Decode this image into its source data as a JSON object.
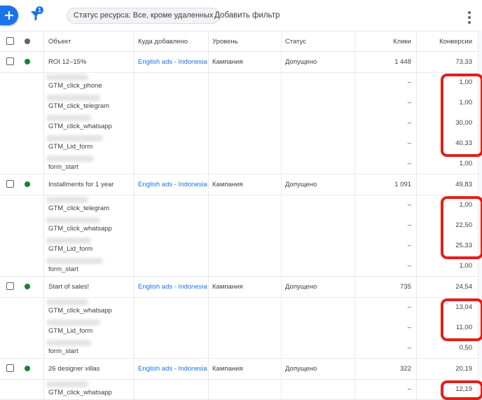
{
  "toolbar": {
    "add_icon": "plus-icon",
    "filter_icon": "filter-icon",
    "filter_badge": "1",
    "status_chip": "Статус ресурса: Все, кроме удаленных",
    "add_filter": "Добавить фильтр",
    "more_icon": "more-vert-icon"
  },
  "columns": {
    "object": "Объект",
    "added_to": "Куда добавлено",
    "level": "Уровень",
    "status": "Статус",
    "clicks": "Клики",
    "conversions": "Конверсии"
  },
  "colors": {
    "accent": "#1a73e8",
    "status_green": "#188038",
    "highlight": "#e0201b"
  },
  "campaigns": [
    {
      "name": "ROI 12–15%",
      "added_to": "English ads - Indonesia",
      "level": "Кампания",
      "status": "Допущено",
      "clicks": "1 448",
      "conversions": "73,33",
      "actions": [
        {
          "name": "GTM_click_phone",
          "clicks": "–",
          "conversions": "1,00"
        },
        {
          "name": "GTM_click_telegram",
          "clicks": "–",
          "conversions": "1,00"
        },
        {
          "name": "GTM_click_whatsapp",
          "clicks": "–",
          "conversions": "30,00"
        },
        {
          "name": "GTM_Lid_form",
          "clicks": "–",
          "conversions": "40,33"
        },
        {
          "name": "form_start",
          "clicks": "–",
          "conversions": "1,00"
        }
      ]
    },
    {
      "name": "Installments for 1 year",
      "added_to": "English ads - Indonesia",
      "level": "Кампания",
      "status": "Допущено",
      "clicks": "1 091",
      "conversions": "49,83",
      "actions": [
        {
          "name": "GTM_click_telegram",
          "clicks": "–",
          "conversions": "1,00"
        },
        {
          "name": "GTM_click_whatsapp",
          "clicks": "–",
          "conversions": "22,50"
        },
        {
          "name": "GTM_Lid_form",
          "clicks": "–",
          "conversions": "25,33"
        },
        {
          "name": "form_start",
          "clicks": "–",
          "conversions": "1,00"
        }
      ]
    },
    {
      "name": "Start of sales!",
      "added_to": "English ads - Indonesia",
      "level": "Кампания",
      "status": "Допущено",
      "clicks": "735",
      "conversions": "24,54",
      "actions": [
        {
          "name": "GTM_click_whatsapp",
          "clicks": "–",
          "conversions": "13,04"
        },
        {
          "name": "GTM_Lid_form",
          "clicks": "–",
          "conversions": "11,00"
        },
        {
          "name": "form_start",
          "clicks": "–",
          "conversions": "0,50"
        }
      ]
    },
    {
      "name": "26 designer villas",
      "added_to": "English ads - Indonesia",
      "level": "Кампания",
      "status": "Допущено",
      "clicks": "322",
      "conversions": "20,19",
      "actions": [
        {
          "name": "GTM_click_whatsapp",
          "clicks": "–",
          "conversions": "12,19"
        }
      ]
    }
  ]
}
